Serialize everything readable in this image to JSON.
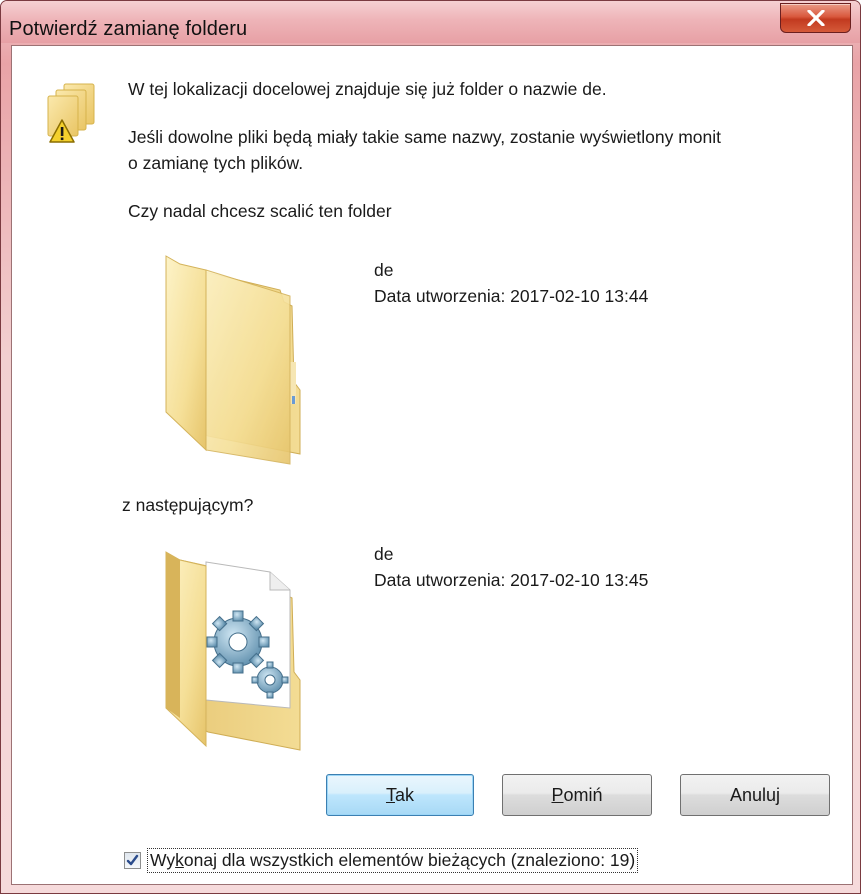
{
  "window": {
    "title": "Potwierdź zamianę folderu",
    "close_symbol": "X",
    "close_icon": "close-icon"
  },
  "message": {
    "line1": "W tej lokalizacji docelowej znajduje się już folder o nazwie de.",
    "line2a": "Jeśli dowolne pliki będą miały takie same nazwy, zostanie wyświetlony monit",
    "line2b": "o zamianę tych plików.",
    "question": "Czy nadal chcesz scalić ten folder",
    "with_label": "z następującym?"
  },
  "source_folder": {
    "icon": "folder-icon",
    "name": "de",
    "created": "Data utworzenia: 2017-02-10 13:44"
  },
  "target_folder": {
    "icon": "folder-with-gears-icon",
    "name": "de",
    "created": "Data utworzenia: 2017-02-10 13:45"
  },
  "buttons": {
    "yes": {
      "mnemonic": "T",
      "rest": "ak"
    },
    "skip": {
      "mnemonic": "P",
      "rest": "omiń"
    },
    "cancel": {
      "label": "Anuluj"
    }
  },
  "apply_all": {
    "checked": true,
    "pre": "Wy",
    "mnemonic": "k",
    "post": "onaj dla wszystkich elementów bieżących (znaleziono: 19)"
  },
  "colors": {
    "titlebar": "#eeb4b8",
    "close_button": "#c23a1f",
    "default_button": "#bee6fd",
    "folder": "#f5dd8e"
  }
}
